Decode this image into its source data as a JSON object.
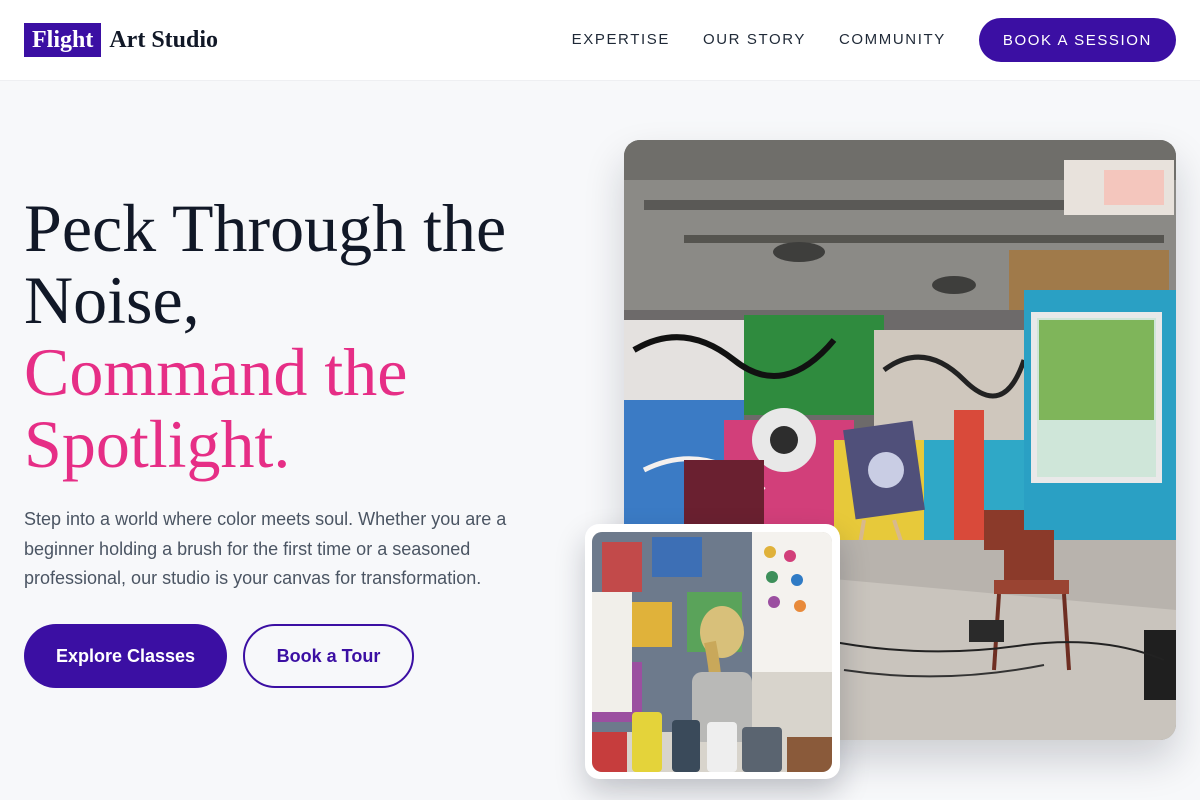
{
  "header": {
    "logo_badge": "Flight",
    "logo_text": "Art Studio",
    "nav": [
      "EXPERTISE",
      "OUR STORY",
      "COMMUNITY"
    ],
    "cta": "BOOK A SESSION"
  },
  "hero": {
    "title_line1": "Peck Through the",
    "title_line2": "Noise,",
    "title_line3": "Command the",
    "title_line4": "Spotlight.",
    "description": "Step into a world where color meets soul. Whether you are a beginner holding a brush for the first time or a seasoned professional, our studio is your canvas for transformation.",
    "primary_button": "Explore Classes",
    "secondary_button": "Book a Tour"
  },
  "images": {
    "main": "graffiti-art-studio-photo",
    "inset": "child-painting-photo"
  },
  "colors": {
    "brand": "#3b0fa3",
    "accent": "#e62e86",
    "text": "#111827",
    "muted": "#4b5563",
    "background": "#f7f8fa"
  }
}
